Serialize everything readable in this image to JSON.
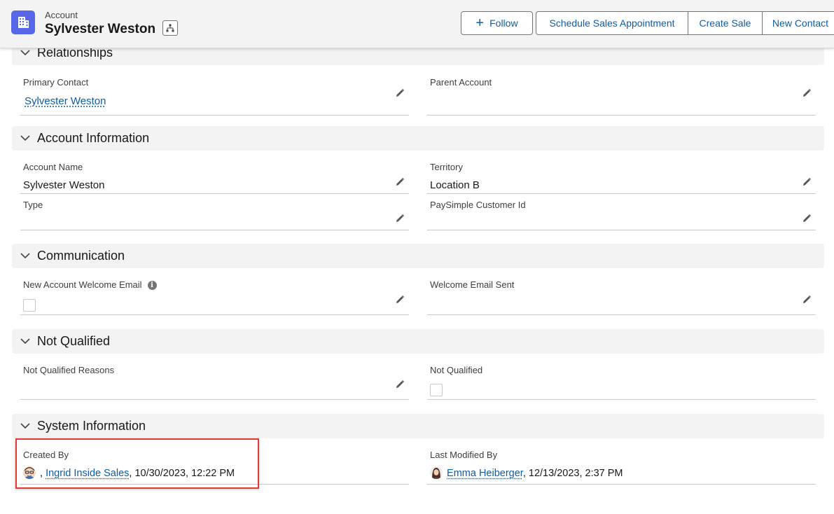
{
  "header": {
    "object_label": "Account",
    "record_title": "Sylvester Weston",
    "icons": {
      "object": "building-icon",
      "hierarchy": "hierarchy-icon"
    },
    "accent_color": "#5867e8"
  },
  "actions": {
    "follow": "Follow",
    "schedule": "Schedule Sales Appointment",
    "create_sale": "Create Sale",
    "new_contact": "New Contact"
  },
  "sections": {
    "relationships": {
      "title": "Relationships",
      "primary_contact_label": "Primary Contact",
      "primary_contact_value": "Sylvester Weston",
      "parent_account_label": "Parent Account",
      "parent_account_value": ""
    },
    "account_info": {
      "title": "Account Information",
      "account_name_label": "Account Name",
      "account_name_value": "Sylvester Weston",
      "territory_label": "Territory",
      "territory_value": "Location B",
      "type_label": "Type",
      "type_value": "",
      "paysimple_label": "PaySimple Customer Id",
      "paysimple_value": ""
    },
    "communication": {
      "title": "Communication",
      "welcome_email_label": "New Account Welcome Email",
      "welcome_email_checked": false,
      "welcome_sent_label": "Welcome Email Sent",
      "welcome_sent_value": ""
    },
    "not_qualified": {
      "title": "Not Qualified",
      "reasons_label": "Not Qualified Reasons",
      "reasons_value": "",
      "not_qualified_label": "Not Qualified",
      "not_qualified_checked": false
    },
    "system_info": {
      "title": "System Information",
      "created_by_label": "Created By",
      "created_by_user": "Ingrid Inside Sales",
      "created_by_date": ", 10/30/2023, 12:22 PM",
      "modified_by_label": "Last Modified By",
      "modified_by_user": "Emma Heiberger",
      "modified_by_date": ", 12/13/2023, 2:37 PM"
    }
  }
}
